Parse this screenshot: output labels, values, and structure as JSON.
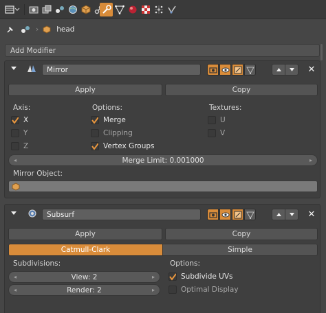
{
  "toolbar": {
    "icons": [
      "view-icon",
      "render-icon",
      "render-layers-icon",
      "scene-icon",
      "world-icon",
      "object-icon",
      "constraints-icon",
      "modifiers-icon",
      "data-icon",
      "material-icon",
      "texture-icon",
      "particles-icon",
      "physics-icon"
    ],
    "active": "modifiers-icon"
  },
  "breadcrumb": {
    "object": "head"
  },
  "add_modifier": {
    "label": "Add Modifier"
  },
  "mirror": {
    "name": "Mirror",
    "apply": "Apply",
    "copy": "Copy",
    "axis_label": "Axis:",
    "options_label": "Options:",
    "textures_label": "Textures:",
    "axis": [
      {
        "label": "X",
        "checked": true
      },
      {
        "label": "Y",
        "checked": false
      },
      {
        "label": "Z",
        "checked": false
      }
    ],
    "options": [
      {
        "label": "Merge",
        "checked": true
      },
      {
        "label": "Clipping",
        "checked": false
      },
      {
        "label": "Vertex Groups",
        "checked": true
      }
    ],
    "textures": [
      {
        "label": "U",
        "checked": false
      },
      {
        "label": "V",
        "checked": false
      }
    ],
    "merge_limit": "Merge Limit: 0.001000",
    "mirror_object_label": "Mirror Object:"
  },
  "subsurf": {
    "name": "Subsurf",
    "apply": "Apply",
    "copy": "Copy",
    "type_options": [
      "Catmull-Clark",
      "Simple"
    ],
    "type_selected": "Catmull-Clark",
    "subdivisions_label": "Subdivisions:",
    "view": "View: 2",
    "render": "Render: 2",
    "options_label": "Options:",
    "subdivide_uvs": {
      "label": "Subdivide UVs",
      "checked": true
    },
    "optimal_display": {
      "label": "Optimal Display",
      "checked": false
    }
  },
  "colors": {
    "accent": "#d98c3a",
    "background": "#464646",
    "panel": "#3f3f3f"
  }
}
